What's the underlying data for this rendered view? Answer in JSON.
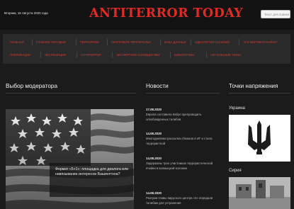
{
  "header": {
    "date": "Вторник, 18 Августа 2020 года",
    "site_title": "ANTITERROR TODAY",
    "search_placeholder": "Текст для поиска"
  },
  "nav": {
    "row1": [
      "Главная",
      "Главное сегодня",
      "Терроризм",
      "География терроризма",
      "База данных",
      "Идеология насилия",
      "\"3-я мировая война\""
    ],
    "row2": [
      "Публикации",
      "Экспозиции",
      "Антитеррор",
      "Экспертное сообщество",
      "Библиотека",
      "Актуальные темы"
    ]
  },
  "columns": {
    "moderator": "Выбор модератора",
    "news": "Новости",
    "hotspots": "Точки напряжения"
  },
  "featured": {
    "caption": "Формат «5+1»: площадка для диалога или навязывание интересов Вашингтона?"
  },
  "news_items": [
    {
      "date": "17.08.2020",
      "title": "Европа составила Кабул препроводить освобожденных талибов"
    },
    {
      "date": "14.08.2020",
      "title": "Многодневная рассылка сбежала в ИГ и стала террористкой"
    },
    {
      "date": "14.08.2020",
      "title": "Задержаны трое участников террористической ячейки в калмыцкой колонии"
    },
    {
      "date": "14.08.2020",
      "title": "Разгром главы вирусного центра «3» передали талибам для устранения"
    }
  ],
  "regions": [
    {
      "name": "Украина",
      "icon": "trident-emblem-icon"
    },
    {
      "name": "Сирия",
      "icon": "syria-photo"
    }
  ],
  "colors": {
    "accent": "#e02a24",
    "nav_text": "#d43c34",
    "background": "#1b1b1b"
  }
}
